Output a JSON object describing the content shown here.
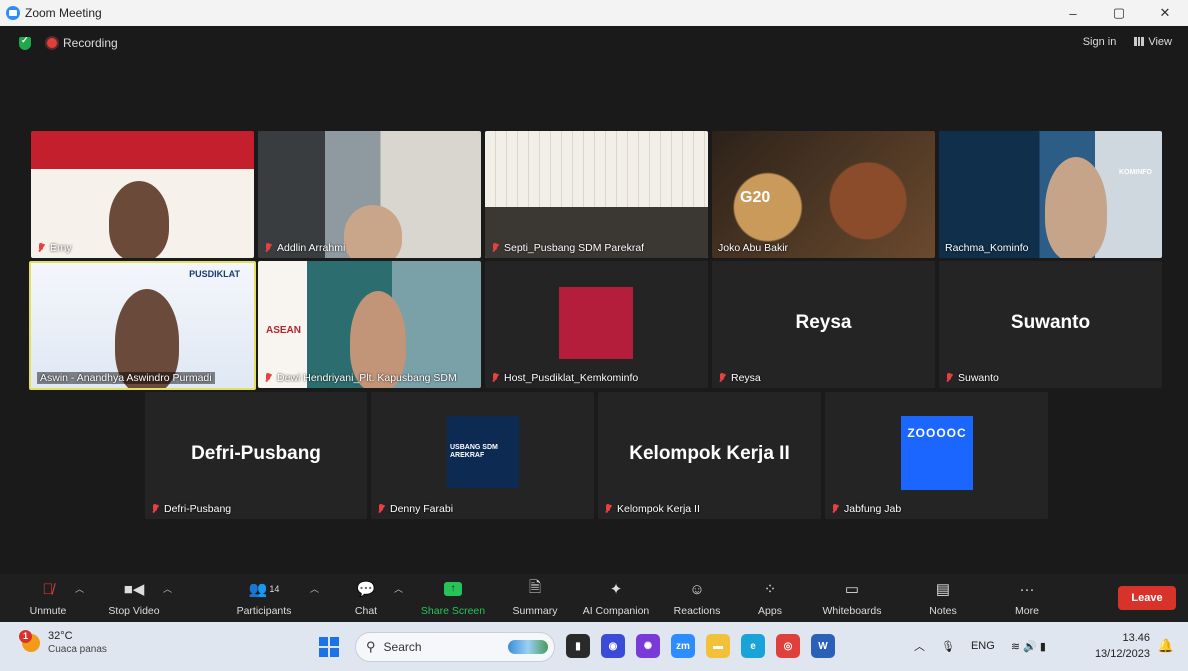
{
  "window": {
    "title": "Zoom Meeting",
    "controls": [
      "–",
      "▢",
      "✕"
    ]
  },
  "topbar": {
    "recording_label": "Recording",
    "sign_in": "Sign in",
    "view": "View"
  },
  "tiles": {
    "erny": {
      "name": "Erny"
    },
    "addlin": {
      "name": "Addlin Arrahmi"
    },
    "septi": {
      "name": "Septi_Pusbang SDM Parekraf"
    },
    "joko": {
      "name": "Joko Abu Bakir",
      "overlay": "G20"
    },
    "rachma": {
      "name": "Rachma_Kominfo",
      "overlay": "KOMINFO"
    },
    "aswin": {
      "name": "Aswin - Anandhya Aswindro Purmadi",
      "overlay": "PUSDIKLAT"
    },
    "dewi": {
      "name": "Dewi Hendriyani_Plt. Kapusbang SDM",
      "overlay": "ASEAN"
    },
    "host": {
      "name": "Host_Pusdiklat_Kemkominfo"
    },
    "reysa": {
      "name": "Reysa",
      "display": "Reysa"
    },
    "suwanto": {
      "name": "Suwanto",
      "display": "Suwanto"
    },
    "defri": {
      "name": "Defri-Pusbang",
      "display": "Defri-Pusbang"
    },
    "denny": {
      "name": "Denny Farabi",
      "overlay": "USBANG SDM AREKRAF"
    },
    "kelompok": {
      "name": "Kelompok Kerja II",
      "display": "Kelompok Kerja II"
    },
    "jabfung": {
      "name": "Jabfung Jab",
      "overlay": "ZOOOOC"
    }
  },
  "toolbar": {
    "unmute": "Unmute",
    "stop_video": "Stop Video",
    "participants": "Participants",
    "participants_count": "14",
    "chat": "Chat",
    "share_screen": "Share Screen",
    "summary": "Summary",
    "ai_companion": "AI Companion",
    "reactions": "Reactions",
    "apps": "Apps",
    "whiteboards": "Whiteboards",
    "notes": "Notes",
    "more": "More",
    "leave": "Leave"
  },
  "taskbar": {
    "weather_temp": "32°C",
    "weather_desc": "Cuaca panas",
    "weather_badge": "1",
    "search_placeholder": "Search",
    "language": "ENG",
    "time": "13.46",
    "date": "13/12/2023"
  },
  "colors": {
    "zoom_blue": "#2d8cff",
    "active_speaker": "#e3e05a",
    "leave_red": "#d8332b",
    "share_green": "#26c35b"
  }
}
